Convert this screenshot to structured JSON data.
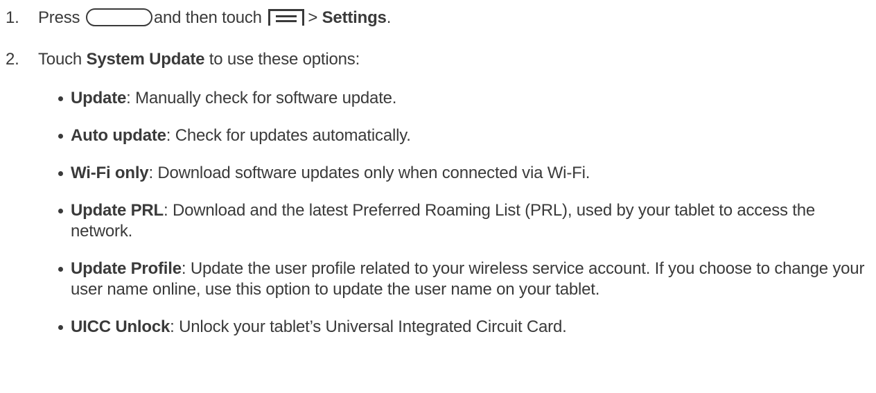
{
  "step1": {
    "number": "1.",
    "press": "Press",
    "home_button_icon": "home-button-icon",
    "and_then_touch": "and then touch",
    "menu_icon": "menu-icon",
    "separator": ">",
    "settings": "Settings",
    "period": "."
  },
  "step2": {
    "number": "2.",
    "touch": "Touch",
    "system_update": "System Update",
    "rest": "to use these options:"
  },
  "options": [
    {
      "term": "Update",
      "desc": ": Manually check for software update."
    },
    {
      "term": "Auto update",
      "desc": ": Check for updates automatically."
    },
    {
      "term": "Wi-Fi only",
      "desc": ": Download software updates only when connected via Wi-Fi."
    },
    {
      "term": "Update PRL",
      "desc": ": Download and the latest Preferred Roaming List (PRL), used by your tablet to access the network."
    },
    {
      "term": "Update Profile",
      "desc": ": Update the user profile related to your wireless service account. If you choose to change your user name online, use this option to update the user name on your tablet."
    },
    {
      "term": "UICC Unlock",
      "desc": ": Unlock your tablet’s Universal Integrated Circuit Card."
    }
  ]
}
